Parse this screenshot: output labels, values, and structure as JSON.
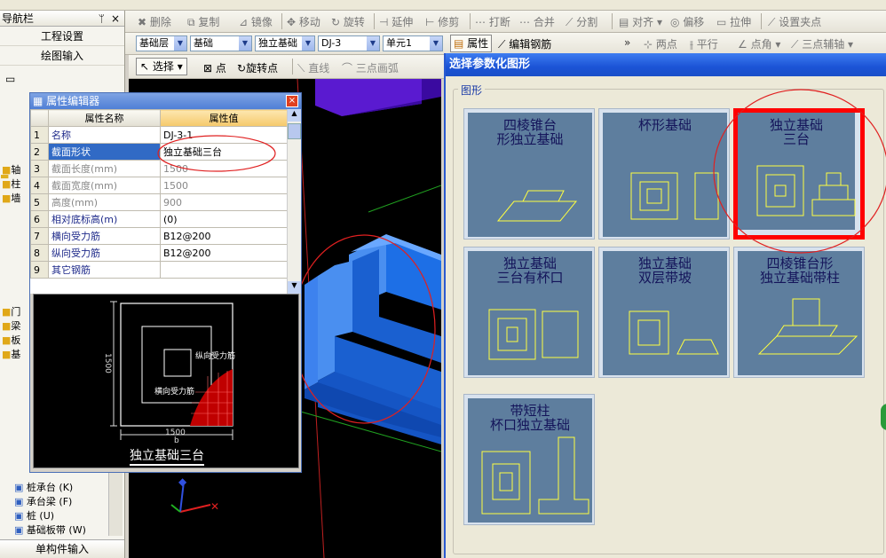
{
  "toolbar_top": {
    "row1_left": [
      "删除",
      "复制",
      "镜像",
      "移动",
      "旋转",
      "延伸",
      "修剪",
      "打断",
      "合并",
      "分割",
      "对齐",
      "偏移",
      "拉伸",
      "设置夹点"
    ],
    "row2": {
      "floor": "基础层",
      "category": "基础",
      "type": "独立基础",
      "component": "DJ-3",
      "unit": "单元1",
      "attr_btn": "属性",
      "edit_rebar_btn": "编辑钢筋",
      "snap": [
        "两点",
        "平行",
        "点角",
        "三点辅轴"
      ]
    },
    "row3": {
      "select": "选择",
      "point": "点",
      "rotate_point": "旋转点",
      "line": "直线",
      "arc": "三点画弧"
    }
  },
  "nav": {
    "title": "导航栏",
    "pin": "ᛘ",
    "close": "×",
    "buttons": [
      "工程设置",
      "绘图输入"
    ],
    "side_labels": [
      "轴",
      "柱",
      "墙",
      "门",
      "梁",
      "板",
      "基"
    ],
    "bottom_items": [
      "桩承台 (K)",
      "承台梁 (F)",
      "桩 (U)",
      "基础板带 (W)"
    ],
    "footer": "单构件输入"
  },
  "prop_editor": {
    "title": "属性编辑器",
    "col_name": "属性名称",
    "col_value": "属性值",
    "rows": [
      {
        "n": "1",
        "k": "名称",
        "v": "DJ-3-1",
        "gray": false
      },
      {
        "n": "2",
        "k": "截面形状",
        "v": "独立基础三台",
        "gray": false
      },
      {
        "n": "3",
        "k": "截面长度(mm)",
        "v": "1500",
        "gray": true
      },
      {
        "n": "4",
        "k": "截面宽度(mm)",
        "v": "1500",
        "gray": true
      },
      {
        "n": "5",
        "k": "高度(mm)",
        "v": "900",
        "gray": true
      },
      {
        "n": "6",
        "k": "相对底标高(m)",
        "v": "(0)",
        "gray": false
      },
      {
        "n": "7",
        "k": "横向受力筋",
        "v": "B12@200",
        "gray": false
      },
      {
        "n": "8",
        "k": "纵向受力筋",
        "v": "B12@200",
        "gray": false
      },
      {
        "n": "9",
        "k": "其它钢筋",
        "v": "",
        "gray": false
      }
    ],
    "preview": {
      "dim_side": "1500",
      "dim_bottom": "1500",
      "dim_b": "b",
      "label_long": "纵向受力筋",
      "label_trans": "横向受力筋",
      "caption": "独立基础三台"
    }
  },
  "dialog": {
    "title": "选择参数化图形",
    "group": "图形",
    "shapes": [
      {
        "l1": "四棱锥台",
        "l2": "形独立基础",
        "selected": false
      },
      {
        "l1": "杯形基础",
        "l2": "",
        "selected": false
      },
      {
        "l1": "独立基础",
        "l2": "三台",
        "selected": true
      },
      {
        "l1": "独立基础",
        "l2": "三台有杯口",
        "selected": false
      },
      {
        "l1": "独立基础",
        "l2": "双层带坡",
        "selected": false
      },
      {
        "l1": "四棱锥台形",
        "l2": "独立基础带柱",
        "selected": false
      },
      {
        "l1": "带短柱",
        "l2": "杯口独立基础",
        "selected": false
      }
    ]
  },
  "colors": {
    "highlight_border": "#ff0000",
    "annotation_circle": "#e02020",
    "card_bg": "#5e7e9e",
    "shape_line": "#ffff40",
    "foundation_blue": "#1d6fe6"
  }
}
